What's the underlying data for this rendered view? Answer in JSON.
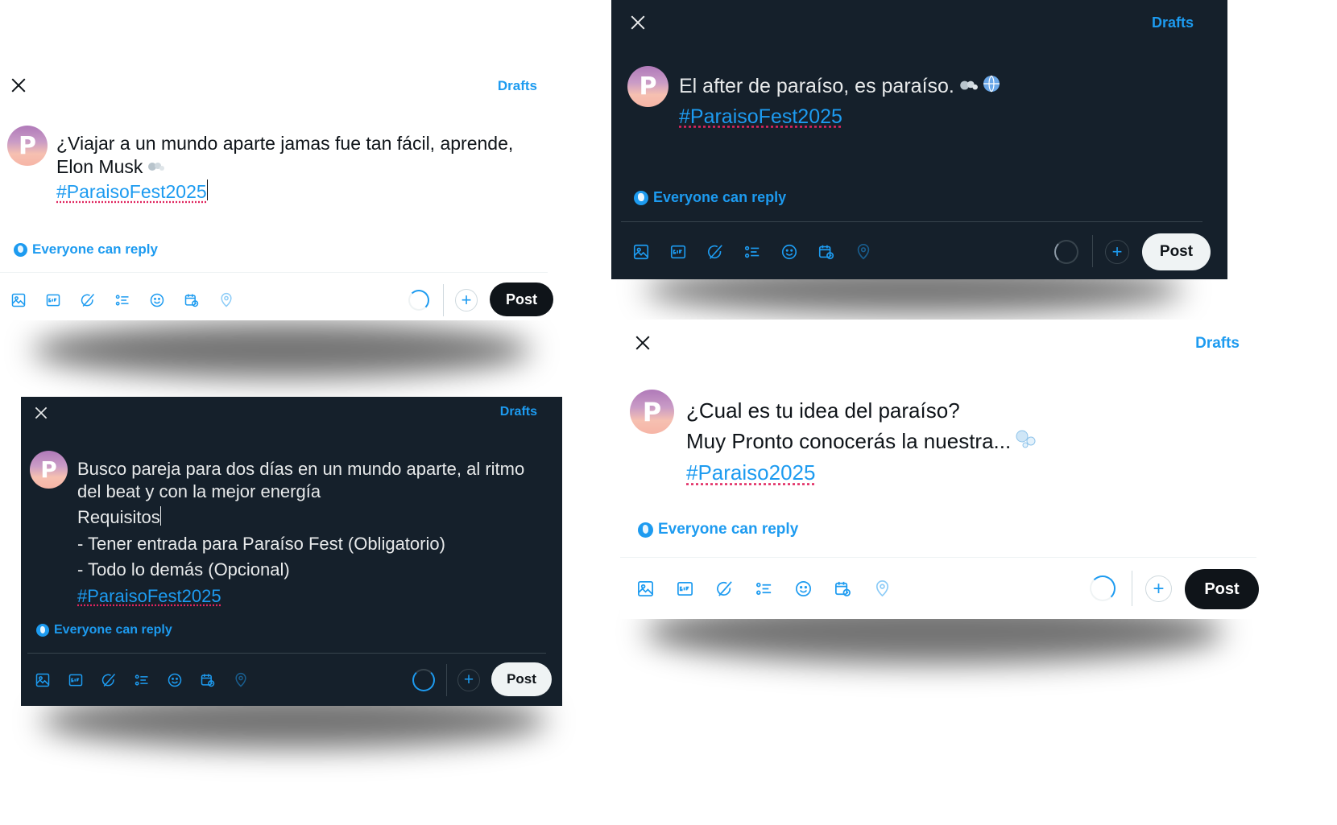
{
  "composers": [
    {
      "theme": "light",
      "drafts_label": "Drafts",
      "avatar_letter": "P",
      "lines": [
        "¿Viajar a un mundo aparte jamas fue tan fácil, aprende,",
        "Elon Musk"
      ],
      "hashtag": "#ParaisoFest2025",
      "reply_label": "Everyone can reply",
      "post_label": "Post"
    },
    {
      "theme": "dark",
      "drafts_label": "Drafts",
      "avatar_letter": "P",
      "lines": [
        "El after de paraíso, es paraíso."
      ],
      "hashtag": "#ParaisoFest2025",
      "reply_label": "Everyone can reply",
      "post_label": "Post"
    },
    {
      "theme": "dark",
      "drafts_label": "Drafts",
      "avatar_letter": "P",
      "lines": [
        "Busco pareja para dos días en un mundo aparte, al ritmo",
        "del beat y con la mejor energía",
        "Requisitos",
        "- Tener entrada para Paraíso Fest (Obligatorio)",
        "- Todo lo demás (Opcional)"
      ],
      "hashtag": "#ParaisoFest2025",
      "reply_label": "Everyone can reply",
      "post_label": "Post"
    },
    {
      "theme": "light",
      "drafts_label": "Drafts",
      "avatar_letter": "P",
      "lines": [
        "¿Cual es tu idea del paraíso?",
        "Muy Pronto conocerás la nuestra..."
      ],
      "hashtag": "#Paraiso2025",
      "reply_label": "Everyone can reply",
      "post_label": "Post"
    }
  ],
  "toolbar_icons": [
    "image-icon",
    "gif-icon",
    "grok-icon",
    "poll-icon",
    "emoji-icon",
    "schedule-icon",
    "location-icon"
  ],
  "colors": {
    "accent": "#1d9bf0",
    "dark_bg": "#15202b",
    "light_text": "#0f1419",
    "dark_text": "#e7e9ea"
  }
}
